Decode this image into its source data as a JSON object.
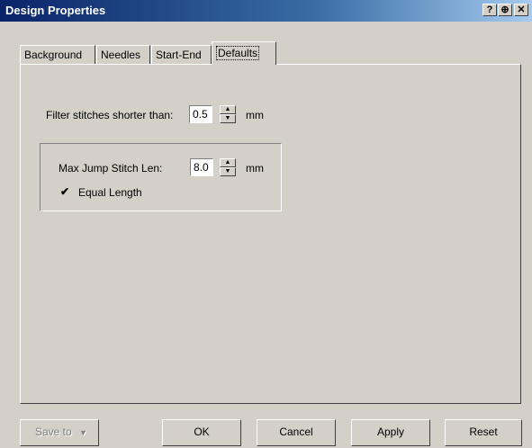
{
  "window": {
    "title": "Design Properties",
    "title_buttons": [
      "help-icon",
      "pin-icon",
      "close-icon"
    ]
  },
  "tabs": [
    {
      "label": "Background",
      "active": false
    },
    {
      "label": "Needles",
      "active": false
    },
    {
      "label": "Start-End",
      "active": false
    },
    {
      "label": "Defaults",
      "active": true
    }
  ],
  "defaults": {
    "filter": {
      "label": "Filter stitches shorter than:",
      "value": "0.5",
      "unit": "mm"
    },
    "max_jump": {
      "label": "Max Jump Stitch Len:",
      "value": "8.0",
      "unit": "mm"
    },
    "equal_length": {
      "label": "Equal Length",
      "checked": true
    }
  },
  "buttons": {
    "save_to": "Save to",
    "ok": "OK",
    "cancel": "Cancel",
    "apply": "Apply",
    "reset": "Reset"
  }
}
